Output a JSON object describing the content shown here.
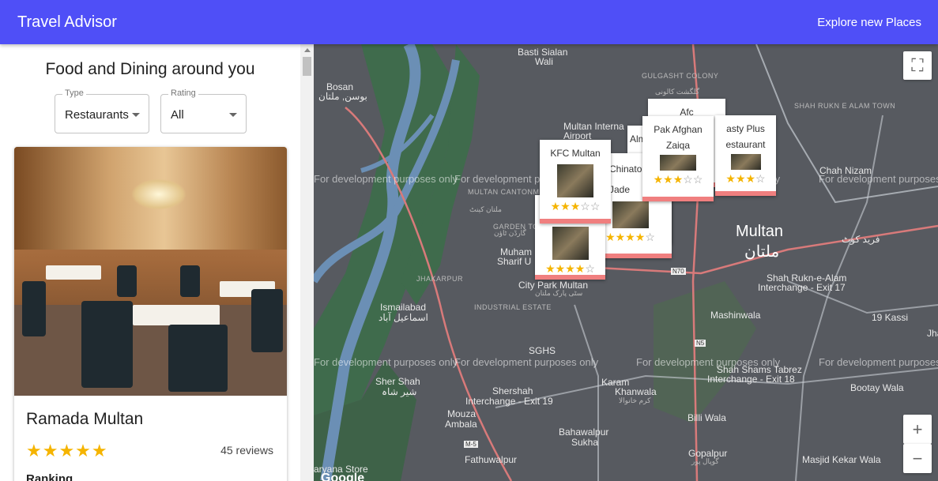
{
  "header": {
    "title": "Travel Advisor",
    "explore": "Explore new Places"
  },
  "sidebar": {
    "heading": "Food and Dining around you",
    "type_filter": {
      "label": "Type",
      "value": "Restaurants"
    },
    "rating_filter": {
      "label": "Rating",
      "value": "All"
    }
  },
  "card": {
    "name": "Ramada Multan",
    "rating": 5,
    "stars": "★★★★★",
    "reviews": "45 reviews",
    "ranking": "Ranking"
  },
  "map": {
    "watermark": "For development purposes only",
    "google": "Google",
    "places": {
      "basti_sialan": "Basti Sialan",
      "wali": "Wali",
      "bosan": "Bosan",
      "bosan_urdu": "بوسن, ملتان",
      "gulgasht_colony": "GULGASHT COLONY",
      "gulgasht_urdu": "گلگشت کالونی",
      "shah_rukn_alam_town": "SHAH RUKN E ALAM TOWN",
      "multan_international": "Multan Interna",
      "airport": "Airport",
      "multan_cantonment": "MULTAN CANTONMENT",
      "cantonment_urdu": "ملتان کینٹ",
      "garden_town": "GARDEN TOWN",
      "garden_town_urdu": "گارڈن ٹاؤن",
      "chah_nizam": "Chah Nizam",
      "multan": "Multan",
      "multan_urdu": "ملتان",
      "fareed_kot": "فرید کوٹ",
      "muham": "Muham",
      "sharif": "Sharif U",
      "jhakarpur": "JHAKARPUR",
      "city_park": "City Park Multan",
      "city_park_urdu": "سٹی پارک ملتان",
      "shah_rukn_interchange": "Shah Rukn-e-Alam",
      "interchange_17": "Interchange - Exit 17",
      "ismailabad": "Ismailabad",
      "ismailabad_urdu": "اسماعیل آباد",
      "industrial_estate": "INDUSTRIAL ESTATE",
      "mashinwala": "Mashinwala",
      "nineteen_kassi": "19 Kassi",
      "jhan": "Jhan",
      "sghs": "SGHS",
      "sher_shah": "Sher Shah",
      "sher_shah_urdu": "شیر شاہ",
      "karam_khanwala": "Karam",
      "khanwala": "Khanwala",
      "khanwala_urdu": "کرم خانوالا",
      "shah_shams": "Shah Shams Tabrez",
      "interchange_18": "Interchange - Exit 18",
      "bootay_wala": "Bootay Wala",
      "shershah": "Shershah",
      "interchange_19": "Interchange - Exit 19",
      "mouza": "Mouza",
      "ambala": "Ambala",
      "bahawalpur_sukha": "Bahawalpur",
      "sukha": "Sukha",
      "billi_wala": "Billi Wala",
      "gopalpur": "Gopalpur",
      "gopalpur_urdu": "گوپال پور",
      "fathuwalpur": "Fathuwalpur",
      "aryana_store": "aryana Store",
      "masjid_kekar": "Masjid Kekar Wala",
      "n5": "N5",
      "n70": "N70",
      "m5": "M-5"
    },
    "markers": [
      {
        "name": "KFC Multan",
        "stars": "★★★",
        "empty": "☆☆"
      },
      {
        "name": "Pak Afghan Zaiqa",
        "stars": "★★★",
        "empty": "☆☆"
      },
      {
        "name": "Afc",
        "stars": "",
        "empty": ""
      },
      {
        "name": "asty Plus",
        "name2": "estaurant",
        "stars": "★★★",
        "empty": "☆"
      },
      {
        "name": "Chinato",
        "name2": "Jade",
        "stars": "★★★★",
        "empty": "☆"
      },
      {
        "name": "Alm",
        "stars": "",
        "empty": ""
      },
      {
        "name": "",
        "stars": "★★★★",
        "empty": "☆"
      }
    ],
    "fullscreen_icon": "fullscreen-icon",
    "zoom_in": "+",
    "zoom_out": "−"
  }
}
